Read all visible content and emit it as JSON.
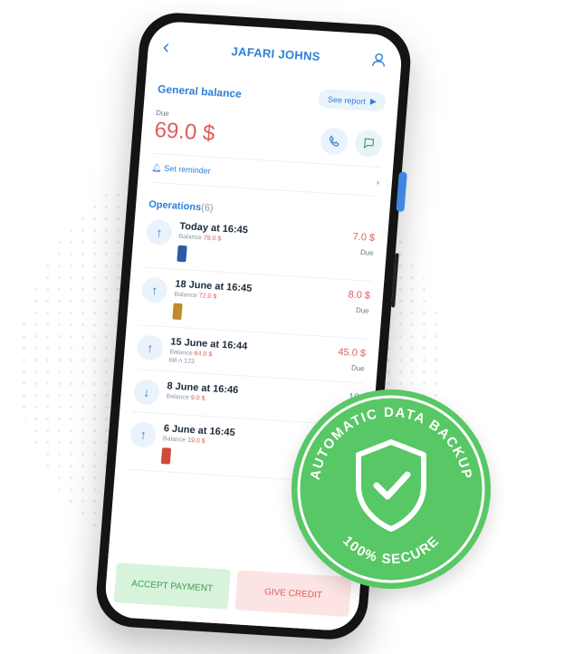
{
  "header": {
    "title": "JAFARI JOHNS"
  },
  "balance": {
    "title": "General balance",
    "report_label": "See report",
    "due_label": "Due",
    "amount": "69.0 $"
  },
  "reminder_label": "Set reminder",
  "operations": {
    "title": "Operations",
    "count": "(6)",
    "items": [
      {
        "date": "Today at 16:45",
        "balance_label": "Balance",
        "balance_value": "79.0 $",
        "note": "",
        "amount": "7.0 $",
        "status": "Due",
        "direction": "up",
        "amount_color": "red"
      },
      {
        "date": "18 June at 16:45",
        "balance_label": "Balance",
        "balance_value": "72.0 $",
        "note": "",
        "amount": "8.0 $",
        "status": "Due",
        "direction": "up",
        "amount_color": "red"
      },
      {
        "date": "15 June at 16:44",
        "balance_label": "Balance",
        "balance_value": "64.0 $",
        "note": "bill n 123",
        "amount": "45.0 $",
        "status": "Due",
        "direction": "up",
        "amount_color": "red"
      },
      {
        "date": "8 June at 16:46",
        "balance_label": "Balance",
        "balance_value": "9.0 $",
        "note": "",
        "amount": "10.",
        "status": "Ad",
        "direction": "down",
        "amount_color": "green"
      },
      {
        "date": "6 June at 16:45",
        "balance_label": "Balance",
        "balance_value": "19.0 $",
        "note": "",
        "amount": "14",
        "status": "",
        "direction": "up",
        "amount_color": "red"
      }
    ]
  },
  "actions": {
    "accept": "ACCEPT PAYMENT",
    "give": "GIVE CREDIT"
  },
  "badge": {
    "top_text": "AUTOMATIC DATA BACKUP",
    "bottom_text": "100% SECURE"
  },
  "colors": {
    "accent": "#2f7fd6",
    "due_red": "#e15a5a",
    "badge_green": "#58c765"
  }
}
